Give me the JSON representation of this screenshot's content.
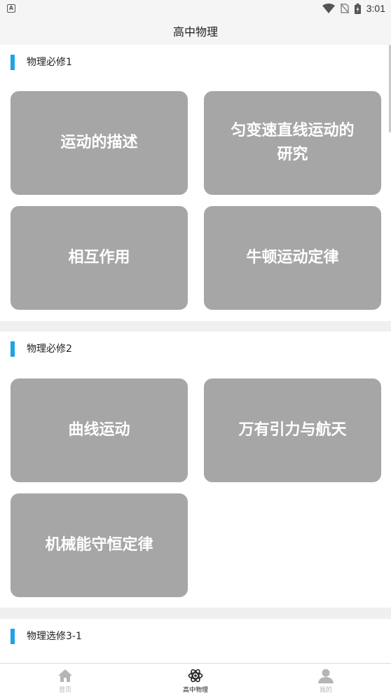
{
  "status_bar": {
    "time": "3:01",
    "left_icon_text": "A"
  },
  "header": {
    "title": "高中物理"
  },
  "sections": [
    {
      "title": "物理必修1",
      "cards": [
        "运动的描述",
        "匀变速直线运动的研究",
        "相互作用",
        "牛顿运动定律"
      ]
    },
    {
      "title": "物理必修2",
      "cards": [
        "曲线运动",
        "万有引力与航天",
        "机械能守恒定律"
      ]
    },
    {
      "title": "物理选修3-1",
      "cards": []
    }
  ],
  "tabs": [
    {
      "label": "首页",
      "icon": "home-icon",
      "active": false
    },
    {
      "label": "高中物理",
      "icon": "atom-icon",
      "active": true
    },
    {
      "label": "我的",
      "icon": "user-icon",
      "active": false
    }
  ],
  "colors": {
    "accent": "#1ea3e8",
    "card_background": "#a6a6a6",
    "card_text": "#ffffff",
    "tab_inactive": "#b5b5b5"
  }
}
